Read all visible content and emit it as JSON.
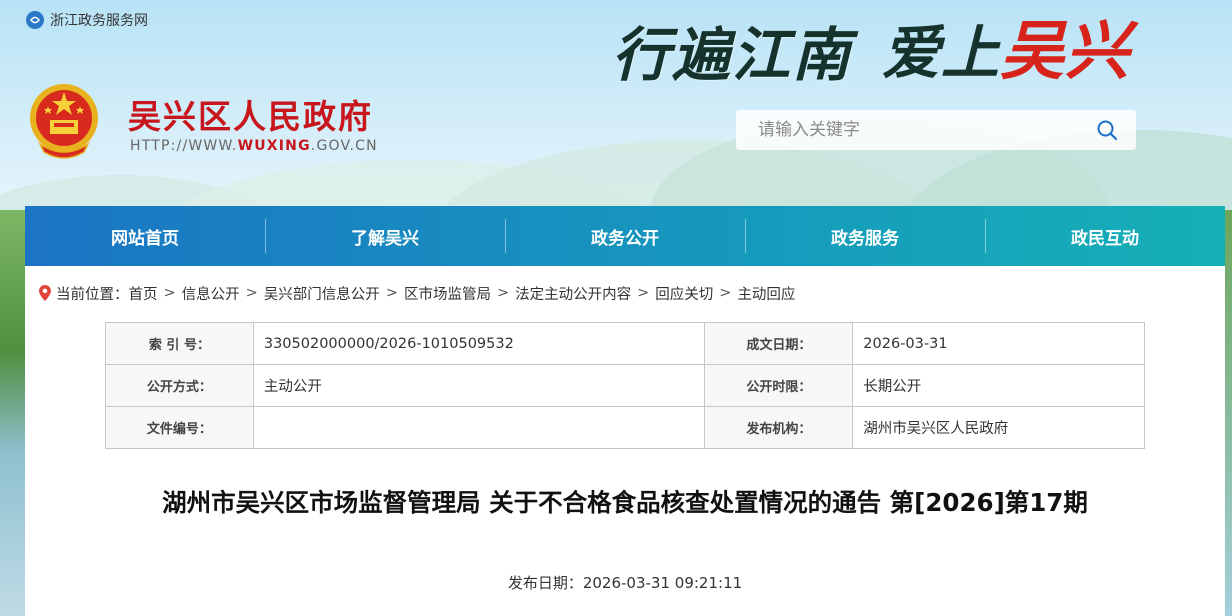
{
  "topbar": {
    "portal_name": "浙江政务服务网"
  },
  "site": {
    "title": "吴兴区人民政府",
    "url_prefix": "HTTP://WWW.",
    "url_highlight": "WUXING",
    "url_suffix": ".GOV.CN"
  },
  "slogan": {
    "part1": "行遍江南",
    "part2": "爱上",
    "part3": "吴兴"
  },
  "search": {
    "placeholder": "请输入关键字"
  },
  "nav": {
    "items": [
      {
        "label": "网站首页"
      },
      {
        "label": "了解吴兴"
      },
      {
        "label": "政务公开"
      },
      {
        "label": "政务服务"
      },
      {
        "label": "政民互动"
      }
    ]
  },
  "breadcrumb": {
    "prefix": "当前位置：",
    "items": [
      "首页",
      "信息公开",
      "吴兴部门信息公开",
      "区市场监管局",
      "法定主动公开内容",
      "回应关切",
      "主动回应"
    ],
    "separator": ">"
  },
  "meta": {
    "index_label": "索 引 号：",
    "index_value": "330502000000/2026-1010509532",
    "date_label": "成文日期：",
    "date_value": "2026-03-31",
    "method_label": "公开方式：",
    "method_value": "主动公开",
    "period_label": "公开时限：",
    "period_value": "长期公开",
    "docno_label": "文件编号：",
    "docno_value": "",
    "issuer_label": "发布机构：",
    "issuer_value": "湖州市吴兴区人民政府"
  },
  "document": {
    "title": "湖州市吴兴区市场监督管理局 关于不合格食品核查处置情况的通告 第[2026]第17期",
    "publish_label": "发布日期：",
    "publish_value": "2026-03-31 09:21:11"
  },
  "colors": {
    "brand_red": "#c8161d",
    "nav_start": "#1b74c4",
    "nav_end": "#15b0b6"
  }
}
